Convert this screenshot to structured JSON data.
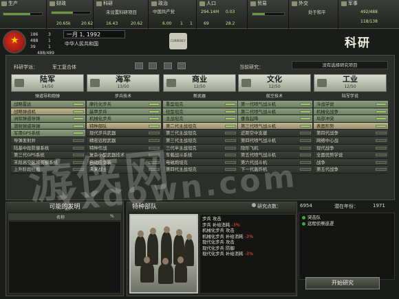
{
  "topbar": {
    "production": {
      "label": "生产",
      "value": "",
      "sub": ""
    },
    "finance": {
      "label": "财政",
      "value": "20.65k",
      "sub": "20.62"
    },
    "research": {
      "label": "科研",
      "alert": "未设置科研项目",
      "value": "16.43",
      "sub": "20.62"
    },
    "politics": {
      "label": "政治",
      "party": "中国共产党",
      "value": "6.00",
      "sub": "1",
      "sub2": "1"
    },
    "manpower": {
      "label": "人口",
      "value": "294.14M",
      "sub": "0.03",
      "sub2": "69",
      "sub3": "28.2"
    },
    "trade": {
      "label": "贸易",
      "value": "",
      "sub": ""
    },
    "diplomacy": {
      "label": "外交",
      "value": "处于和平"
    },
    "military": {
      "label": "军事",
      "value": "492/488",
      "sub": "118/138"
    }
  },
  "country": {
    "stats": [
      "186",
      "488",
      "39"
    ],
    "stats2": [
      "3",
      "1",
      "1"
    ],
    "ratio": "488/489",
    "date": "一月 1, 1992",
    "name": "中华人民共和国",
    "currency": "CURRENCY"
  },
  "page_title": "科研",
  "research": {
    "school_label": "科研学派：",
    "school_value": "军工复合体",
    "current_label": "当前研究：",
    "current_value": "没有选择研究项目",
    "categories": [
      {
        "name": "陆军",
        "count": "14/50"
      },
      {
        "name": "海军",
        "count": "13/50"
      },
      {
        "name": "商业",
        "count": "12/50"
      },
      {
        "name": "文化",
        "count": "12/50"
      },
      {
        "name": "工业",
        "count": "12/50"
      }
    ],
    "subheaders": [
      "弹道导和炮弹",
      "步兵技术",
      "新武器",
      "航空技术",
      "陆军学说"
    ],
    "columns": [
      [
        {
          "t": "战略雷达",
          "s": "g"
        },
        {
          "t": "战略弹道机",
          "s": "y"
        },
        {
          "t": "洲际弹道导弹",
          "s": "g"
        },
        {
          "t": "潜射弹道导弹",
          "s": "g"
        },
        {
          "t": "军用GPS系统",
          "s": "g"
        },
        {
          "t": "导弹发射井",
          "s": "d"
        },
        {
          "t": "陆基中段防御系统",
          "s": "d"
        },
        {
          "t": "第三代GPS系统",
          "s": "d"
        },
        {
          "t": "末段高空区域防御系统",
          "s": "d"
        },
        {
          "t": "上升阶段拦截",
          "s": "d"
        }
      ],
      [
        {
          "t": "摩托化步兵",
          "s": "g"
        },
        {
          "t": "装甲步兵",
          "s": "g"
        },
        {
          "t": "机械化步兵",
          "s": "g"
        },
        {
          "t": "特种部队",
          "s": "y"
        },
        {
          "t": "现代步兵武器",
          "s": "d"
        },
        {
          "t": "精密远程武器",
          "s": "d"
        },
        {
          "t": "特种作战",
          "s": "d"
        },
        {
          "t": "复杂小型武器技术",
          "s": "d"
        },
        {
          "t": "自动应急装",
          "s": "d"
        },
        {
          "t": "未来战士",
          "s": "d"
        }
      ],
      [
        {
          "t": "重型坦克",
          "s": "g"
        },
        {
          "t": "轻型坦克",
          "s": "g"
        },
        {
          "t": "主战坦克",
          "s": "g"
        },
        {
          "t": "第二代主战坦克",
          "s": "y"
        },
        {
          "t": "第三代主战坦克",
          "s": "d"
        },
        {
          "t": "第三代主战坦克",
          "s": "d"
        },
        {
          "t": "三代半主战坦克",
          "s": "d"
        },
        {
          "t": "车载战斗系统",
          "s": "d"
        },
        {
          "t": "电磁炮坦克",
          "s": "d"
        },
        {
          "t": "第四代主战坦克",
          "s": "d"
        }
      ],
      [
        {
          "t": "第一代喷气战斗机",
          "s": "g"
        },
        {
          "t": "第二代喷气战斗机",
          "s": "g"
        },
        {
          "t": "垂直起降",
          "s": "g"
        },
        {
          "t": "第三代喷气战斗机",
          "s": "y"
        },
        {
          "t": "近距空中支援",
          "s": "d"
        },
        {
          "t": "第四代喷气战斗机",
          "s": "d"
        },
        {
          "t": "隐形飞机",
          "s": "d"
        },
        {
          "t": "第五代喷气战斗机",
          "s": "d"
        },
        {
          "t": "第六代战斗机",
          "s": "d"
        },
        {
          "t": "下一代轰炸机",
          "s": "d"
        }
      ],
      [
        {
          "t": "冷战学说",
          "s": "g"
        },
        {
          "t": "机械化战争",
          "s": "g"
        },
        {
          "t": "局部冲突",
          "s": "g"
        },
        {
          "t": "表面形势",
          "s": "y"
        },
        {
          "t": "第四代战争",
          "s": "d"
        },
        {
          "t": "网络中心战",
          "s": "d"
        },
        {
          "t": "现代战争",
          "s": "d"
        },
        {
          "t": "全面优势学说",
          "s": "d"
        },
        {
          "t": "战争",
          "s": "d"
        },
        {
          "t": "第五代战争",
          "s": "d"
        }
      ]
    ]
  },
  "inventions": {
    "title": "可能的发明",
    "col_name": "名称",
    "col_pct": "%"
  },
  "team": {
    "title": "特种部队",
    "points_label": "研究点数：",
    "points_value": "6954",
    "year_label": "潜在年份：",
    "year_value": "1971",
    "effects": [
      {
        "a": "步兵 攻击",
        "b": "",
        "c": ""
      },
      {
        "a": "步兵 补给消耗",
        "b": "",
        "c": "-3%"
      },
      {
        "a": "机械化步兵 攻击",
        "b": "",
        "c": ""
      },
      {
        "a": "机械化步兵 补给消耗",
        "b": "",
        "c": "-3%"
      },
      {
        "a": "现代化步兵 攻击",
        "b": "",
        "c": ""
      },
      {
        "a": "现代化步兵 防御",
        "b": "",
        "c": ""
      },
      {
        "a": "现代化步兵 补给消耗",
        "b": "",
        "c": "-3%"
      }
    ],
    "queue": [
      "突击队",
      "远程侦察巡逻"
    ],
    "start_button": "开始研究"
  },
  "watermark": {
    "line1": "游侠网",
    "line2": "Yxdown.com"
  }
}
